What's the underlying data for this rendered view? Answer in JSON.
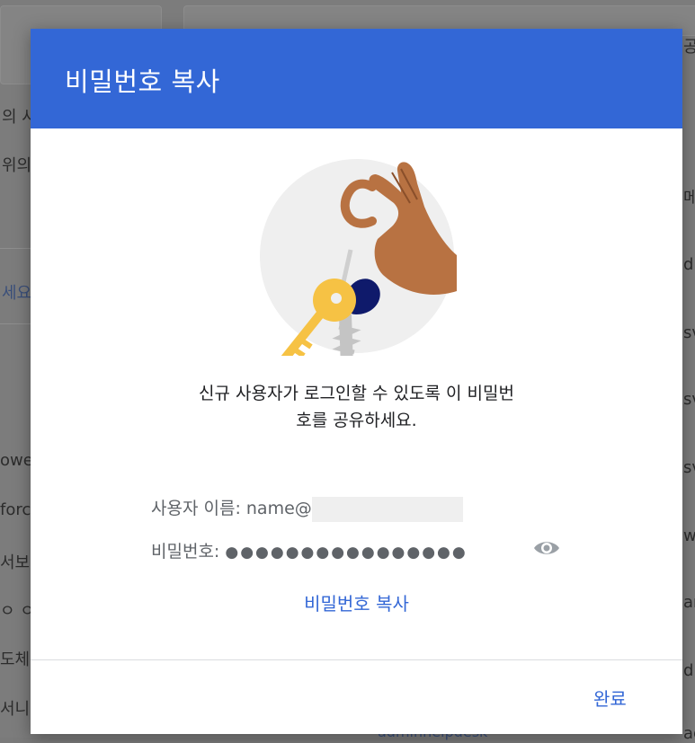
{
  "background": {
    "left_texts": [
      "의 사",
      "위의",
      "세요",
      "owe",
      "forc",
      "서보l",
      "ㅇ ㅇ",
      "도체",
      "서니"
    ],
    "right_texts": [
      "공지",
      "메",
      "dr",
      "sv",
      "sv",
      "sv",
      "w",
      "an",
      "dr",
      "adr"
    ],
    "bottom_link": "adminhelpdesk"
  },
  "dialog": {
    "title": "비밀번호 복사",
    "message_line1": "신규 사용자가 로그인할 수 있도록 이 비밀번",
    "message_line2": "호를 공유하세요.",
    "username_label": "사용자 이름: name@",
    "password_label": "비밀번호: ",
    "password_masked": "●●●●●●●●●●●●●●●●",
    "copy_password_label": "비밀번호 복사",
    "done_label": "완료"
  },
  "colors": {
    "header": "#3367d6",
    "link": "#3367d6",
    "key": "#f6c244",
    "hand": "#b87242",
    "tag": "#0f1a6b"
  }
}
